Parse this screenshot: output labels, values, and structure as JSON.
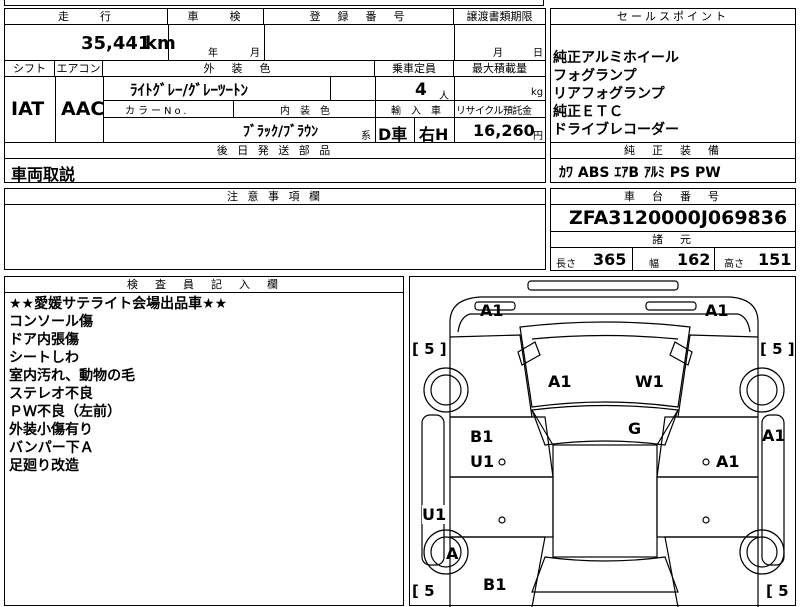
{
  "top": {
    "mileage_label": "走　　行",
    "shaken_label": "車　　検",
    "reg_label": "登　録　番　号",
    "transfer_label": "譲渡書類期限",
    "mileage_value": "35,441",
    "mileage_unit": "km",
    "shaken_year": "年",
    "shaken_month": "月",
    "transfer_month": "月",
    "transfer_day": "日"
  },
  "spec": {
    "shift_label": "シフト",
    "ac_label": "エアコン",
    "ext_color_label": "外　装　色",
    "capacity_label": "乗車定員",
    "max_load_label": "最大積載量",
    "shift_value": "IAT",
    "ac_value": "AAC",
    "ext_color_value": "ﾗｲﾄｸﾞﾚｰ/ｸﾞﾚｰﾂｰﾄﾝ",
    "capacity_value": "4",
    "capacity_unit": "人",
    "load_unit": "kg",
    "color_no_label": "カラーNo.",
    "int_color_label": "内　装　色",
    "import_label": "輸　入　車",
    "recycle_label": "リサイクル預託金",
    "int_color_value": "ﾌﾞﾗｯｸ/ﾌﾞﾗｳﾝ",
    "int_color_suffix": "系",
    "import_value": "D車",
    "handle_value": "右H",
    "recycle_value": "16,260",
    "recycle_unit": "円"
  },
  "later_parts": {
    "label": "後 日 発 送 部 品",
    "value": "車両取説"
  },
  "notes": {
    "label": "注 意 事 項 欄"
  },
  "selling_points": {
    "label": "セールスポイント",
    "items": [
      "純正アルミホイール",
      "フォグランプ",
      "リアフォグランプ",
      "純正ＥＴＣ",
      "ドライブレコーダー"
    ]
  },
  "equipment": {
    "label": "純　正　装　備",
    "value": "ｶﾜ ABS ｴｱB ｱﾙﾐ PS PW"
  },
  "chassis": {
    "label": "車　台　番　号",
    "value": "ZFA3120000J069836"
  },
  "dims": {
    "label": "諸　元",
    "length_label": "長さ",
    "length_value": "365",
    "width_label": "幅",
    "width_value": "162",
    "height_label": "高さ",
    "height_value": "151"
  },
  "inspector": {
    "label": "検　査　員　記　入　欄",
    "lines": [
      "★★愛媛サテライト会場出品車★★",
      "コンソール傷",
      "ドア内張傷",
      "シートしわ",
      "室内汚れ、動物の毛",
      "ステレオ不良",
      "ＰＷ不良（左前）",
      "外装小傷有り",
      "バンパー下Ａ",
      "足廻り改造"
    ]
  },
  "diagram": {
    "marks": {
      "front_left": "A1",
      "front_right": "A1",
      "hood_left": "A1",
      "hood_right": "W1",
      "left_door_front": "B1",
      "left_door_front_2": "U1",
      "roof": "G",
      "right_fender": "A1",
      "right_door": "A1",
      "left_rear": "U1",
      "left_wheel_rear": "A",
      "rear": "B1",
      "tire_fl": "[ 5 ]",
      "tire_fr": "[ 5 ]",
      "tire_rl": "[ 5",
      "tire_rr": "[ 5"
    }
  }
}
